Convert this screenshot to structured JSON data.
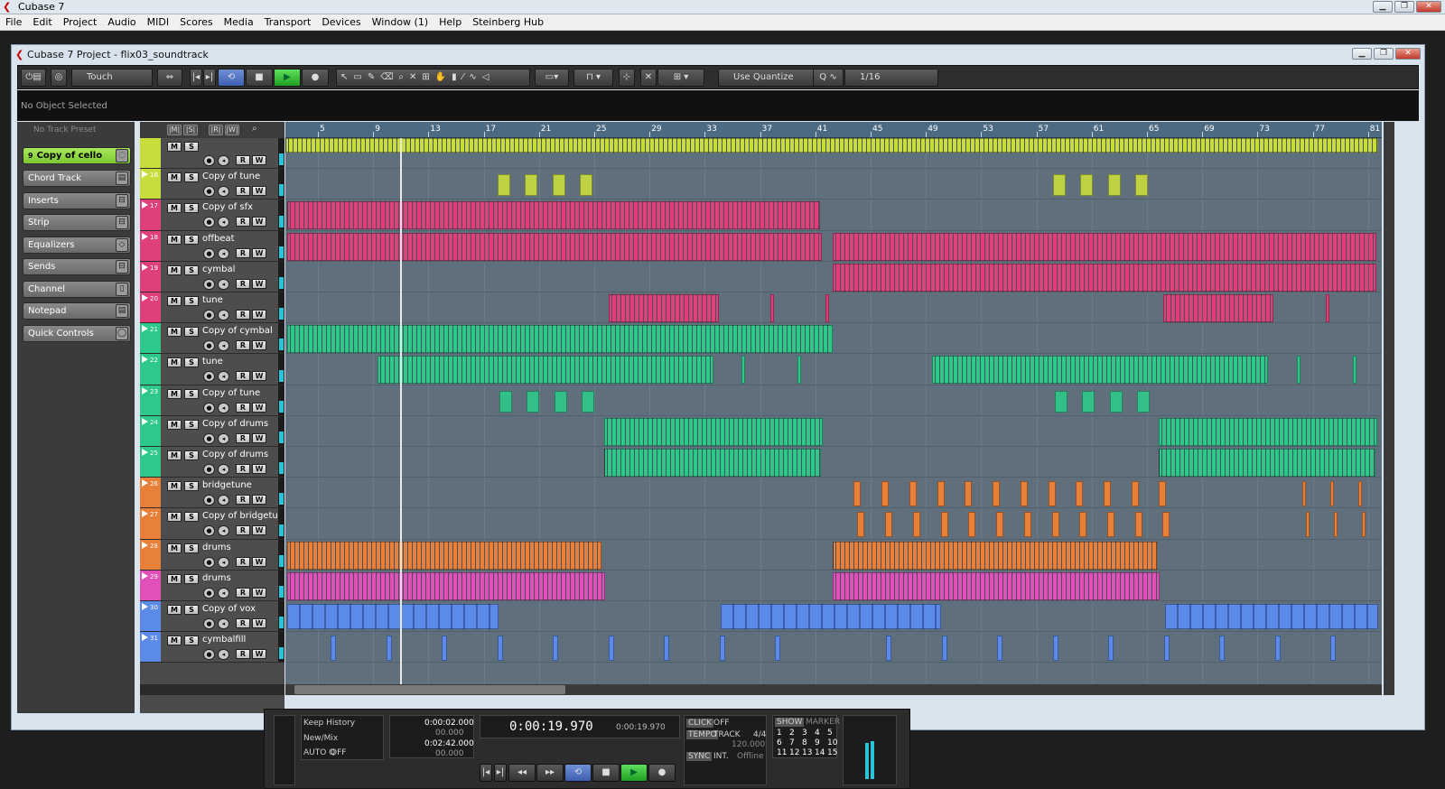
{
  "app": {
    "title": "Cubase 7"
  },
  "menu": [
    "File",
    "Edit",
    "Project",
    "Audio",
    "MIDI",
    "Scores",
    "Media",
    "Transport",
    "Devices",
    "Window (1)",
    "Help",
    "Steinberg Hub"
  ],
  "project": {
    "title": "Cubase 7 Project - flix03_soundtrack"
  },
  "toolbar": {
    "automation_mode": "Touch",
    "quantize_mode": "Use Quantize",
    "quantize_value": "1/16"
  },
  "info_line": "No Object Selected",
  "inspector": {
    "preset": "No Track Preset",
    "selected_track": "Copy of cello",
    "selected_track_number": "9",
    "sections": [
      "Chord Track",
      "Inserts",
      "Strip",
      "Equalizers",
      "Sends",
      "Channel",
      "Notepad",
      "Quick Controls"
    ]
  },
  "ruler": {
    "bars": [
      "5",
      "9",
      "13",
      "17",
      "21",
      "25",
      "29",
      "33",
      "37",
      "41",
      "45",
      "49",
      "53",
      "57",
      "61",
      "65",
      "69",
      "73",
      "77",
      "81"
    ]
  },
  "tracks": [
    {
      "num": "",
      "name": "",
      "color": "#c8dc3c"
    },
    {
      "num": "16",
      "name": "Copy of tune",
      "color": "#c8dc3c"
    },
    {
      "num": "17",
      "name": "Copy of sfx",
      "color": "#e0407a"
    },
    {
      "num": "18",
      "name": "offbeat",
      "color": "#e0407a"
    },
    {
      "num": "19",
      "name": "cymbal",
      "color": "#e0407a"
    },
    {
      "num": "20",
      "name": "tune",
      "color": "#e0407a"
    },
    {
      "num": "21",
      "name": "Copy of cymbal",
      "color": "#2ec88a"
    },
    {
      "num": "22",
      "name": "tune",
      "color": "#2ec88a"
    },
    {
      "num": "23",
      "name": "Copy of tune",
      "color": "#2ec88a"
    },
    {
      "num": "24",
      "name": "Copy of drums",
      "color": "#2ec88a"
    },
    {
      "num": "25",
      "name": "Copy of drums",
      "color": "#2ec88a"
    },
    {
      "num": "26",
      "name": "bridgetune",
      "color": "#e8803a"
    },
    {
      "num": "27",
      "name": "Copy of bridgetun",
      "color": "#e8803a"
    },
    {
      "num": "28",
      "name": "drums",
      "color": "#e8803a"
    },
    {
      "num": "29",
      "name": "drums",
      "color": "#e050b8"
    },
    {
      "num": "30",
      "name": "Copy of vox",
      "color": "#5c8ae8"
    },
    {
      "num": "31",
      "name": "cymbalfill",
      "color": "#5c8ae8"
    }
  ],
  "transport": {
    "history_1": "Keep History",
    "history_2": "New/Mix",
    "auto_q_label": "AUTO Q",
    "auto_q_value": "OFF",
    "left_locator": "0:00:02.000",
    "left_sub": "00.000",
    "right_locator": "0:02:42.000",
    "right_sub": "00.000",
    "main_time": "0:00:19.970",
    "secondary_time": "0:00:19.970",
    "click_label": "CLICK",
    "click_value": "OFF",
    "tempo_label": "TEMPO",
    "tempo_mode": "TRACK",
    "signature": "4/4",
    "tempo_value": "120.000",
    "sync_label": "SYNC",
    "sync_mode": "INT.",
    "sync_status": "Offline",
    "show_label": "SHOW",
    "marker_label": "MARKER",
    "markers": [
      "1",
      "2",
      "3",
      "4",
      "5",
      "6",
      "7",
      "8",
      "9",
      "10",
      "11",
      "12",
      "13",
      "14",
      "15"
    ]
  }
}
